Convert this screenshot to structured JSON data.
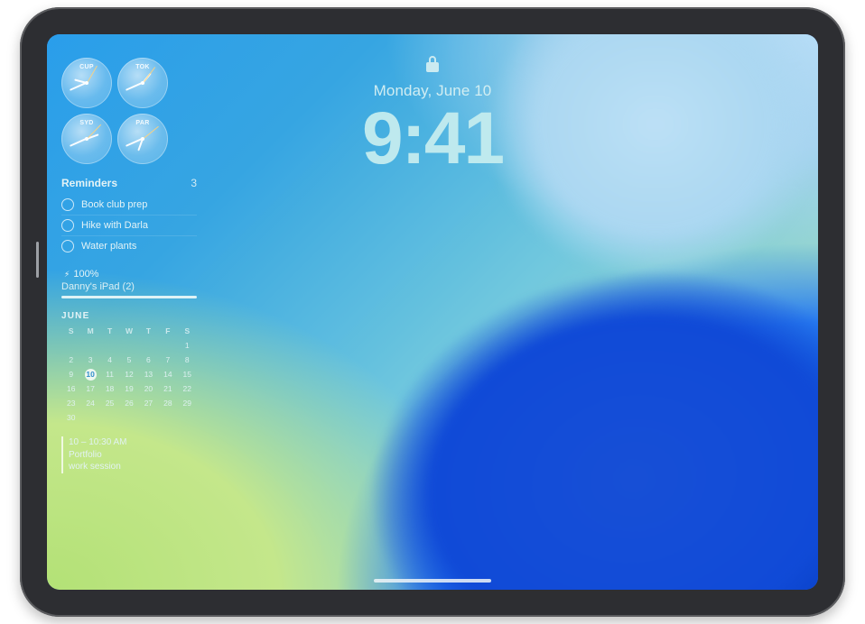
{
  "lock": {
    "date": "Monday, June 10",
    "time": "9:41"
  },
  "widgets": {
    "clocks": {
      "items": [
        {
          "label": "CUP",
          "hourDeg": 285,
          "minDeg": 246
        },
        {
          "label": "TOK",
          "hourDeg": 40,
          "minDeg": 246
        },
        {
          "label": "SYD",
          "hourDeg": 70,
          "minDeg": 246
        },
        {
          "label": "PAR",
          "hourDeg": 200,
          "minDeg": 246
        }
      ]
    },
    "reminders": {
      "title": "Reminders",
      "count": "3",
      "items": [
        {
          "label": "Book club prep"
        },
        {
          "label": "Hike with Darla"
        },
        {
          "label": "Water plants"
        }
      ]
    },
    "battery": {
      "percent_label": "100%",
      "device_name": "Danny's iPad (2)",
      "percent": 100
    },
    "calendar": {
      "month_label": "JUNE",
      "dow": [
        "S",
        "M",
        "T",
        "W",
        "T",
        "F",
        "S"
      ],
      "weeks": [
        [
          "",
          "",
          "",
          "",
          "",
          "",
          "1"
        ],
        [
          "2",
          "3",
          "4",
          "5",
          "6",
          "7",
          "8"
        ],
        [
          "9",
          "10",
          "11",
          "12",
          "13",
          "14",
          "15"
        ],
        [
          "16",
          "17",
          "18",
          "19",
          "20",
          "21",
          "22"
        ],
        [
          "23",
          "24",
          "25",
          "26",
          "27",
          "28",
          "29"
        ],
        [
          "30",
          "",
          "",
          "",
          "",
          "",
          ""
        ]
      ],
      "today": "10"
    },
    "event": {
      "time": "10 – 10:30 AM",
      "title_line1": "Portfolio",
      "title_line2": "work session"
    }
  }
}
